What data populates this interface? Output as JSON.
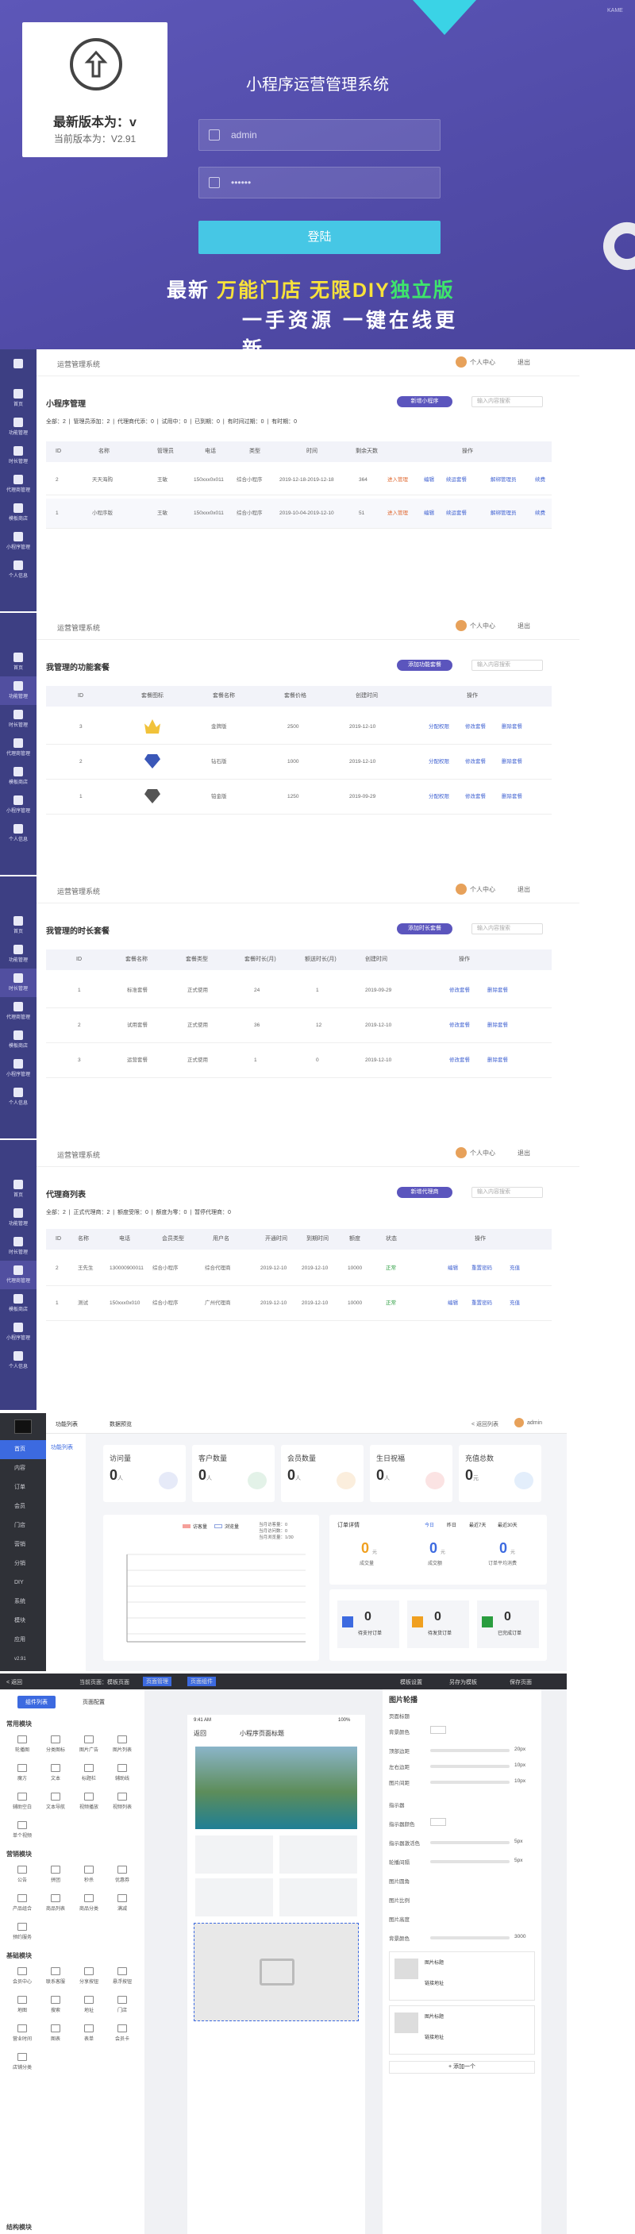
{
  "login": {
    "brand_tag": "KAME",
    "version_title": "最新版本为：v",
    "version_current": "当前版本为：V2.91",
    "system_title": "小程序运营管理系统",
    "username": "admin",
    "password": "••••••",
    "login_button": "登陆",
    "slogan_1a": "最新",
    "slogan_1b": "万能门店",
    "slogan_1c": "无限DIY",
    "slogan_1d": "独立版",
    "slogan_2": "一手资源  一键在线更新"
  },
  "common": {
    "system_name": "运营管理系统",
    "personal": "个人中心",
    "logout": "退出",
    "search_placeholder": "输入内容搜索"
  },
  "sidebar": [
    "首页",
    "功能管理",
    "时长管理",
    "代理商管理",
    "模板商店",
    "小程序管理",
    "个人信息"
  ],
  "panel1": {
    "title": "小程序管理",
    "add": "新增小程序",
    "filters": [
      "全部：2",
      "管理员添加：2",
      "代理商代添：0",
      "试用中：0",
      "已到期：0",
      "有时间过期：0",
      "有时期：0"
    ],
    "headers": [
      "ID",
      "名称",
      "管理员",
      "电话",
      "类型",
      "时间",
      "剩余天数",
      "",
      "操作"
    ],
    "rows": [
      [
        "2",
        "天天海购",
        "王敏",
        "150xxx0x011",
        "综合小程序",
        "2019-12-18-2019-12-18",
        "364",
        "进入管理",
        "编辑",
        "续运套餐",
        "解绑管理员",
        "续费"
      ],
      [
        "1",
        "小程序版",
        "王敏",
        "150xxx0x011",
        "综合小程序",
        "2019-10-04-2019-12-10",
        "51",
        "进入管理",
        "编辑",
        "续运套餐",
        "解绑管理员",
        "续费"
      ]
    ]
  },
  "panel2": {
    "title": "我管理的功能套餐",
    "add": "添加功能套餐",
    "headers": [
      "ID",
      "套餐图标",
      "套餐名称",
      "套餐价格",
      "创建时间",
      "操作"
    ],
    "rows": [
      [
        "3",
        "金牌版",
        "2500",
        "2019-12-10",
        "分配权限",
        "修改套餐",
        "删除套餐"
      ],
      [
        "2",
        "钻石版",
        "1000",
        "2019-12-10",
        "分配权限",
        "修改套餐",
        "删除套餐"
      ],
      [
        "1",
        "铂金版",
        "1250",
        "2019-09-29",
        "分配权限",
        "修改套餐",
        "删除套餐"
      ]
    ]
  },
  "panel3": {
    "title": "我管理的时长套餐",
    "add": "添加时长套餐",
    "headers": [
      "ID",
      "套餐名称",
      "套餐类型",
      "套餐时长(月)",
      "额送时长(月)",
      "创建时间",
      "操作"
    ],
    "rows": [
      [
        "1",
        "标准套餐",
        "正式使用",
        "24",
        "1",
        "2019-09-29",
        "修改套餐",
        "删除套餐"
      ],
      [
        "2",
        "试用套餐",
        "正式使用",
        "36",
        "12",
        "2019-12-10",
        "修改套餐",
        "删除套餐"
      ],
      [
        "3",
        "运营套餐",
        "正式使用",
        "1",
        "0",
        "2019-12-10",
        "修改套餐",
        "删除套餐"
      ]
    ]
  },
  "panel4": {
    "title": "代理商列表",
    "add": "新增代理商",
    "filters": [
      "全部：2",
      "正式代理商：2",
      "额度受限：0",
      "额度为零：0",
      "暂停代理商：0"
    ],
    "headers": [
      "ID",
      "名称",
      "电话",
      "会员类型",
      "用户名",
      "开通时间",
      "到期时间",
      "额度",
      "状态",
      "操作"
    ],
    "rows": [
      [
        "2",
        "王先生",
        "130000900011",
        "综合小程序",
        "综合代理商",
        "2019-12-10",
        "2019-12-10",
        "10000",
        "正常",
        "编辑",
        "重置密码",
        "充值"
      ],
      [
        "1",
        "测试",
        "150xxx0x010",
        "综合小程序",
        "广州代理商",
        "2019-12-10",
        "2019-12-10",
        "10000",
        "正常",
        "编辑",
        "重置密码",
        "充值"
      ]
    ]
  },
  "dashboard": {
    "menu": [
      "首页",
      "内容",
      "订单",
      "会员",
      "门店",
      "营销",
      "分销",
      "DIY",
      "系统",
      "模块",
      "应用"
    ],
    "version": "v2.91",
    "tabs": [
      "功能列表",
      "数据预览"
    ],
    "back": "< 返回列表",
    "admin": "admin",
    "sub_menu": "功能列表",
    "cards": [
      [
        "访问量",
        "0",
        "人"
      ],
      [
        "客户数量",
        "0",
        "人"
      ],
      [
        "会员数量",
        "0",
        "人"
      ],
      [
        "生日祝福",
        "0",
        "人"
      ],
      [
        "充值总数",
        "0",
        "元"
      ]
    ],
    "chart_legend": [
      "访客量",
      "浏览量"
    ],
    "chart_meta": [
      "当月访客量：0",
      "当月访问数：0",
      "当月浏览量：1/30"
    ],
    "order_title": "订单详情",
    "order_tabs": [
      "今日",
      "昨日",
      "最近7天",
      "最近30天"
    ],
    "order_items": [
      [
        "0",
        "元",
        "成交量"
      ],
      [
        "0",
        "元",
        "成交额"
      ],
      [
        "0",
        "元",
        "订单平均消费"
      ]
    ],
    "rev_items": [
      [
        "0",
        "待支付订单"
      ],
      [
        "0",
        "待发货订单"
      ],
      [
        "0",
        "已完成订单"
      ]
    ]
  },
  "editor": {
    "top_left": "< 返回",
    "top_tabs": [
      "当前页面：模板页面",
      "页面管理",
      "页面组件"
    ],
    "top_right": [
      "模板设置",
      "另存为模板",
      "保存页面"
    ],
    "left_tabs": [
      "组件列表",
      "页面配置"
    ],
    "groups": [
      "常用模块",
      "营销模块",
      "基础模块",
      "结构模块"
    ],
    "common_items": [
      "轮播图",
      "分类图标",
      "图片广告",
      "图片列表",
      "魔方",
      "文本",
      "标题栏",
      "辅助线",
      "辅助空白",
      "文本导航",
      "视频播放",
      "视频列表",
      "单个视频"
    ],
    "marketing_items": [
      "公告",
      "拼团",
      "秒杀",
      "优惠券",
      "产品组合",
      "商品列表",
      "商品分类",
      "满减",
      "预约服务"
    ],
    "base_items": [
      "会员中心",
      "联系客服",
      "分享按钮",
      "悬浮按钮",
      "地图",
      "搜索",
      "地址",
      "门店",
      "营业时间",
      "图表",
      "表单",
      "会员卡",
      "店铺分类"
    ],
    "phone_status": "9:41 AM",
    "phone_battery": "100%",
    "phone_title": "小程序页面标题",
    "phone_back": "返回",
    "panel_title": "图片轮播",
    "labels": [
      "页面标题",
      "背景颜色",
      "顶部边距",
      "左右边距",
      "图片间距",
      "指示器",
      "指示器颜色",
      "指示器激活色",
      "轮播间隔",
      "图片圆角",
      "图片比例",
      "图片高度",
      "背景颜色"
    ],
    "values": [
      "20px",
      "10px",
      "10px",
      "5px",
      "5px",
      "3000"
    ],
    "image_label": "图片标题",
    "image_link": "链接地址",
    "add_image": "+ 添加一个"
  }
}
